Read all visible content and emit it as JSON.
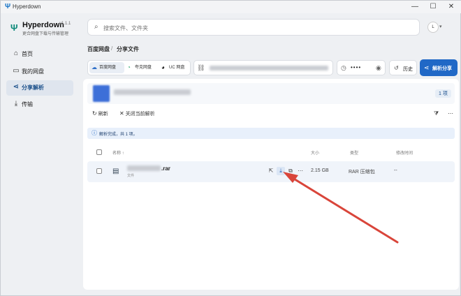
{
  "window": {
    "title": "Hyperdown",
    "controls": [
      "—",
      "☐",
      "✕"
    ]
  },
  "brand": {
    "name": "Hyperdown",
    "version": "v1.1.1",
    "subtitle": "更合网盘下载与传输管理"
  },
  "sidebar": {
    "items": [
      {
        "label": "首页",
        "icon": "home-icon",
        "glyph": "⌂"
      },
      {
        "label": "我的网盘",
        "icon": "folder-icon",
        "glyph": "▭"
      },
      {
        "label": "分享解析",
        "icon": "share-icon",
        "glyph": "⋖"
      },
      {
        "label": "传输",
        "icon": "download-icon",
        "glyph": "⤓"
      }
    ],
    "active_index": 2
  },
  "search": {
    "placeholder": "搜索文件、文件夹"
  },
  "user": {
    "avatar_text": "L"
  },
  "breadcrumb": {
    "root": "百度网盘",
    "separator": "/",
    "current": "分享文件"
  },
  "providers": [
    {
      "label": "百度网盘",
      "glyph": "☁"
    },
    {
      "label": "夸克网盘",
      "glyph": "◔"
    },
    {
      "label": "UC 网盘",
      "glyph": "◕"
    }
  ],
  "password": {
    "masked": "••••"
  },
  "history_button": {
    "label": "历史"
  },
  "parse_button": {
    "label": "解析分享"
  },
  "share": {
    "count_label": "1 项"
  },
  "toolbar": {
    "refresh_label": "刷新",
    "close_label": "关闭当前解析"
  },
  "info": {
    "message": "解析完成，共 1 项。"
  },
  "table": {
    "headers": {
      "name": "名称 ↑",
      "size": "大小",
      "type": "类型",
      "modified": "修改时间"
    },
    "rows": [
      {
        "name_suffix": ".rar",
        "sub": "文件",
        "size": "2.15 GB",
        "type": "RAR 压缩包",
        "modified": "--"
      }
    ]
  },
  "colors": {
    "accent": "#2068c6",
    "annotation_arrow": "#d9453a"
  }
}
